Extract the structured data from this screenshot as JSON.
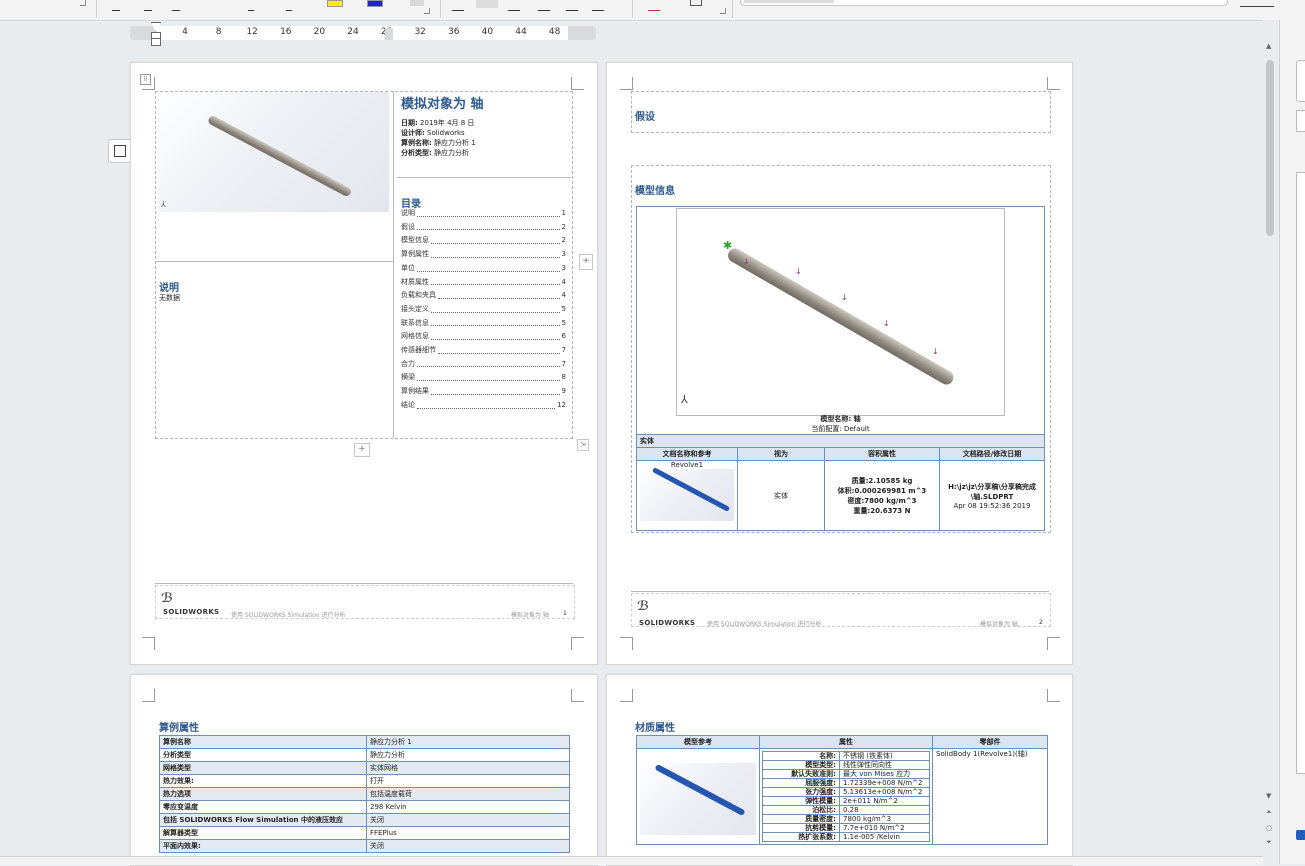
{
  "ruler": {
    "ticks": [
      "4",
      "8",
      "12",
      "16",
      "20",
      "24",
      "28",
      "32",
      "36",
      "40",
      "44",
      "48"
    ]
  },
  "page1": {
    "title": "模拟对象为 轴",
    "meta": [
      {
        "label": "日期:",
        "value": "2019年 4月 8 日"
      },
      {
        "label": "设计师:",
        "value": "Solidworks"
      },
      {
        "label": "算例名称:",
        "value": "静应力分析 1"
      },
      {
        "label": "分析类型:",
        "value": "静应力分析"
      }
    ],
    "toc_heading": "目录",
    "toc": [
      {
        "label": "说明",
        "page": "1"
      },
      {
        "label": "假设",
        "page": "2"
      },
      {
        "label": "模型信息",
        "page": "2"
      },
      {
        "label": "算例属性",
        "page": "3"
      },
      {
        "label": "单位",
        "page": "3"
      },
      {
        "label": "材质属性",
        "page": "4"
      },
      {
        "label": "负载和夹具",
        "page": "4"
      },
      {
        "label": "接头定义",
        "page": "5"
      },
      {
        "label": "联系信息",
        "page": "5"
      },
      {
        "label": "网格信息",
        "page": "6"
      },
      {
        "label": "传感器细节",
        "page": "7"
      },
      {
        "label": "合力",
        "page": "7"
      },
      {
        "label": "横梁",
        "page": "8"
      },
      {
        "label": "算例结果",
        "page": "9"
      },
      {
        "label": "结论",
        "page": "12"
      }
    ],
    "desc_heading": "说明",
    "desc_text": "无数据",
    "footer_logo": "SOLIDWORKS",
    "footer_text": "使用 SOLIDWORKS Simulation 进行分析",
    "footer_right": "模拟对象为 轴",
    "footer_page": "1"
  },
  "page2": {
    "assume_heading": "假设",
    "model_heading": "模型信息",
    "model_name_label": "模型名称: 轴",
    "config_label": "当前配置: Default",
    "solid_label": "实体",
    "table_headers": [
      "文档名称和参考",
      "视为",
      "容积属性",
      "文档路径/修改日期"
    ],
    "body_name": "Revolve1",
    "treated_as": "实体",
    "props": [
      "质量:2.10585 kg",
      "体积:0.000269981 m^3",
      "密度:7800 kg/m^3",
      "重量:20.6373 N"
    ],
    "path": [
      "H:\\jz\\jz\\分享稿\\分享稿完成",
      "\\轴.SLDPRT",
      "Apr 08 19:52:36 2019"
    ],
    "footer_logo": "SOLIDWORKS",
    "footer_text": "使用 SOLIDWORKS Simulation 进行分析",
    "footer_right": "模拟对象为 轴",
    "footer_page": "2"
  },
  "page3": {
    "heading": "算例属性",
    "rows": [
      {
        "k": "算例名称",
        "v": "静应力分析 1"
      },
      {
        "k": "分析类型",
        "v": "静应力分析"
      },
      {
        "k": "网格类型",
        "v": "实体网格"
      },
      {
        "k": "热力效果:",
        "v": "打开"
      },
      {
        "k": "热力选项",
        "v": "包括温度载荷"
      },
      {
        "k": "零应变温度",
        "v": "298 Kelvin"
      },
      {
        "k": "包括 SOLIDWORKS Flow Simulation 中的液压效应",
        "v": "关闭"
      },
      {
        "k": "解算器类型",
        "v": "FFEPlus"
      },
      {
        "k": "平面内效果:",
        "v": "关闭"
      }
    ]
  },
  "page4": {
    "heading": "材质属性",
    "headers": [
      "模型参考",
      "属性",
      "零部件"
    ],
    "props": [
      {
        "k": "名称:",
        "v": "不锈钢 (铁素体)"
      },
      {
        "k": "模型类型:",
        "v": "线性弹性同向性"
      },
      {
        "k": "默认失败准则:",
        "v": "最大 von Mises 应力"
      },
      {
        "k": "屈服强度:",
        "v": "1.72339e+008 N/m^2"
      },
      {
        "k": "张力强度:",
        "v": "5.13613e+008 N/m^2"
      },
      {
        "k": "弹性模量:",
        "v": "2e+011 N/m^2"
      },
      {
        "k": "泊松比:",
        "v": "0.28"
      },
      {
        "k": "质量密度:",
        "v": "7800 kg/m^3"
      },
      {
        "k": "抗剪模量:",
        "v": "7.7e+010 N/m^2"
      },
      {
        "k": "热扩张系数:",
        "v": "1.1e-005 /Kelvin"
      }
    ],
    "component": "SolidBody 1(Revolve1)(轴)"
  },
  "colors": {
    "heading": "#2e5a8e",
    "table_border": "#6f8fb5",
    "header_fill": "#dbe5f1"
  }
}
